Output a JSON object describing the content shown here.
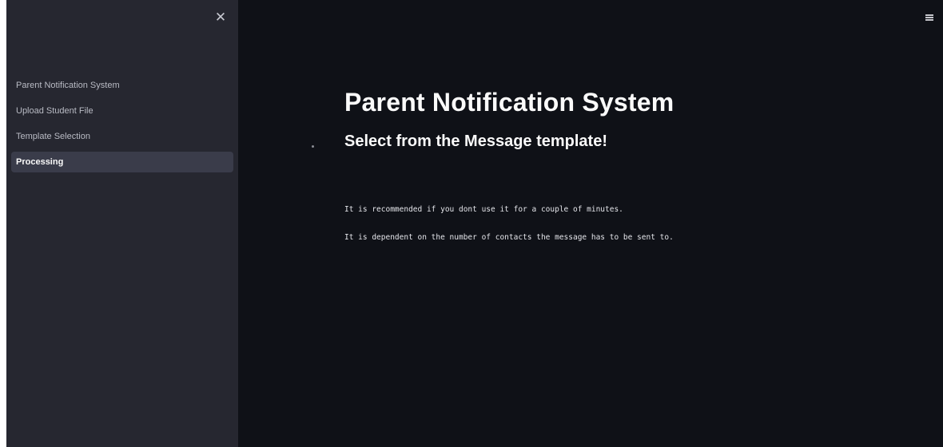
{
  "sidebar": {
    "close_icon": "close-icon",
    "items": [
      {
        "label": "Parent Notification System",
        "active": false
      },
      {
        "label": "Upload Student File",
        "active": false
      },
      {
        "label": "Template Selection",
        "active": false
      },
      {
        "label": "Processing",
        "active": true
      }
    ]
  },
  "header": {
    "menu_icon": "hamburger-menu-icon"
  },
  "main": {
    "title": "Parent Notification System",
    "subtitle": "Select from the Message template!",
    "notes": [
      "It is recommended if you dont use it for a couple of minutes.",
      "It is dependent on the number of contacts the message has to be sent to."
    ]
  },
  "colors": {
    "sidebar_bg": "#262730",
    "main_bg": "#0f1117",
    "active_item_bg": "#3a3c4a",
    "text_primary": "#fafafa"
  }
}
